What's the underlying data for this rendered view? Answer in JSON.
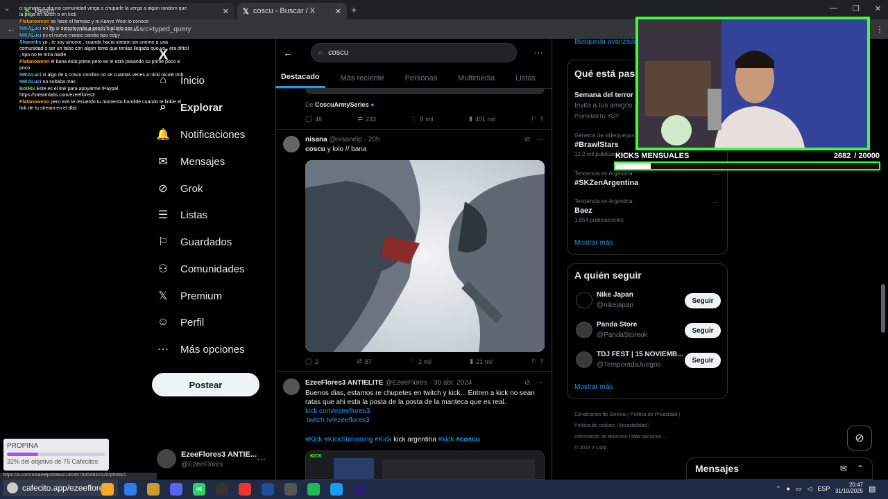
{
  "browser": {
    "tabs": [
      {
        "label": "Beam",
        "active": false
      },
      {
        "label": "coscu - Buscar / X",
        "active": true
      }
    ],
    "url": "x.com/search?q=coscu&src=typed_query",
    "status_url": "https://x.com/nisanelp/status/1804979454831520/photo/1"
  },
  "x": {
    "logo": "X",
    "nav": [
      {
        "label": "Inicio",
        "icon": "home-icon"
      },
      {
        "label": "Explorar",
        "icon": "search-icon"
      },
      {
        "label": "Notificaciones",
        "icon": "bell-icon"
      },
      {
        "label": "Mensajes",
        "icon": "mail-icon"
      },
      {
        "label": "Grok",
        "icon": "grok-icon"
      },
      {
        "label": "Listas",
        "icon": "list-icon"
      },
      {
        "label": "Guardados",
        "icon": "bookmark-icon"
      },
      {
        "label": "Comunidades",
        "icon": "people-icon"
      },
      {
        "label": "Premium",
        "icon": "x-icon"
      },
      {
        "label": "Perfil",
        "icon": "person-icon"
      },
      {
        "label": "Más opciones",
        "icon": "more-icon"
      }
    ],
    "post_button": "Postear",
    "account": {
      "name": "EzeeFlores3 ANTIE...",
      "handle": "@EzeeFlores"
    },
    "search_value": "coscu",
    "tabs": [
      "Destacado",
      "Más reciente",
      "Personas",
      "Multimedia",
      "Listas"
    ],
    "tweet0": {
      "from_prefix": "De",
      "from": "CoscuArmySeries",
      "replies": "46",
      "reposts": "233",
      "likes": "8 mil",
      "views": "401 mil"
    },
    "tweet1": {
      "name": "nisana",
      "handle": "@nisanelp",
      "time": "20h",
      "text_bold": "coscu",
      "text_rest": " y lolo // bana",
      "replies": "2",
      "reposts": "87",
      "likes": "2 mil",
      "views": "21 mil"
    },
    "tweet2": {
      "name": "EzeeFlores3 ANTIELITE",
      "handle": "@EzeeFlores",
      "date": "30 abr. 2024",
      "text": "Buenos dias, estamos re chupetes en twitch y kick... Entren a kick no sean ratas que ahi esta la posta de la posta de la manteca que es real.",
      "link1": "kick.com/ezeeflores3",
      "link2": "twitch.tv/ezeeflores3",
      "hashtags": "#Kick #KickStreaming #Kick",
      "plain": " kick argentina ",
      "hashtags2": "#kick",
      "bold_tag": "#coscu",
      "preview_label": "KICK"
    },
    "right": {
      "advanced_search": "Búsqueda avanzada",
      "trends_title": "Qué está pasando",
      "promo_title": "Semana del terror",
      "promo_sub": "Invitá a tus amigos",
      "promo_by": "Promoted by YOY",
      "trends": [
        {
          "meta": "Géneros de videojuegos",
          "title": "#BrawlStars",
          "count": "12,2 mil publicaciones"
        },
        {
          "meta": "Tendencia en Argentina",
          "title": "#SKZenArgentina",
          "count": ""
        },
        {
          "meta": "Tendencia en Argentina",
          "title": "Baez",
          "count": "1.854 publicaciones"
        }
      ],
      "show_more": "Mostrar más",
      "follow_title": "A quién seguir",
      "follows": [
        {
          "name": "Nike Japan",
          "handle": "@nikejapan",
          "button": "Seguir"
        },
        {
          "name": "Panda Store",
          "handle": "@PandaStoreok",
          "button": "Seguir"
        },
        {
          "name": "TDJ FEST | 15 NOVIEMB...",
          "handle": "@TemporadaJuegos",
          "button": "Seguir"
        }
      ],
      "footer": [
        "Condiciones de Servicio",
        "Política de Privacidad",
        "Política de cookies",
        "Accesibilidad",
        "Información de anuncios",
        "Más opciones ...",
        "© 2025 X Corp."
      ],
      "messages": "Mensajes"
    }
  },
  "overlay": {
    "chat": [
      {
        "user": "",
        "msg": "o sumarte a alguna comunidad verga o chuparle la verga a algún random que la pega en twitch o en kick",
        "color": "#fff"
      },
      {
        "user": "Platanoweon",
        "msg": "se hace el famoso y ni Kanye West lo conoce",
        "color": "#f5a623"
      },
      {
        "user": "NIKALuci",
        "msg": "no se si detesto mas a coscu o al lolo ese",
        "color": "#4fc3f7"
      },
      {
        "user": "NIKALuci",
        "msg": "es el nuevo matias candia tipo edgy",
        "color": "#4fc3f7"
      },
      {
        "user": "Shaninks",
        "msg": "yo , te soy sincero , cuando hacia stream sin unirme a una comunidad o ser un falso con algún tonto que tenías llegada que yo , era difícil , tipo no te mira nadie",
        "color": "#4fc3f7"
      },
      {
        "user": "Platanoweon",
        "msg": "el bana está prime pero se le está pasando su prime poco a poco",
        "color": "#f5a623"
      },
      {
        "user": "NIKALuci",
        "msg": "vi algo de q coscu nombro no se cuantas veces a nicki nicole tmb",
        "color": "#4fc3f7"
      },
      {
        "user": "NIKALuci",
        "msg": "no soltaba mas",
        "color": "#4fc3f7"
      },
      {
        "user": "BotRix",
        "msg": "Este es el link para apoyarme !Paypal https://streamlabs.com/ezeeflores3",
        "color": "#7bd96b"
      },
      {
        "user": "Platanoweon",
        "msg": "pero eze te recuerdo tu momento humilde cuando te linkie el link de tu stream en el dbd",
        "color": "#f5a623"
      }
    ],
    "kicks_label": "KICKS MENSUALES",
    "kicks_value": "2682",
    "kicks_goal": "/ 20000",
    "kicks_progress": 0.134,
    "tip_title": "PROPINA",
    "tip_text": "32% del objetivo de 75 Cafecitos",
    "tip_progress": 0.32,
    "cafecito": "cafecito.app/ezeeflores3"
  },
  "taskbar": {
    "lang": "ESP",
    "time": "20:47",
    "date": "31/10/2025",
    "badge": "46"
  }
}
